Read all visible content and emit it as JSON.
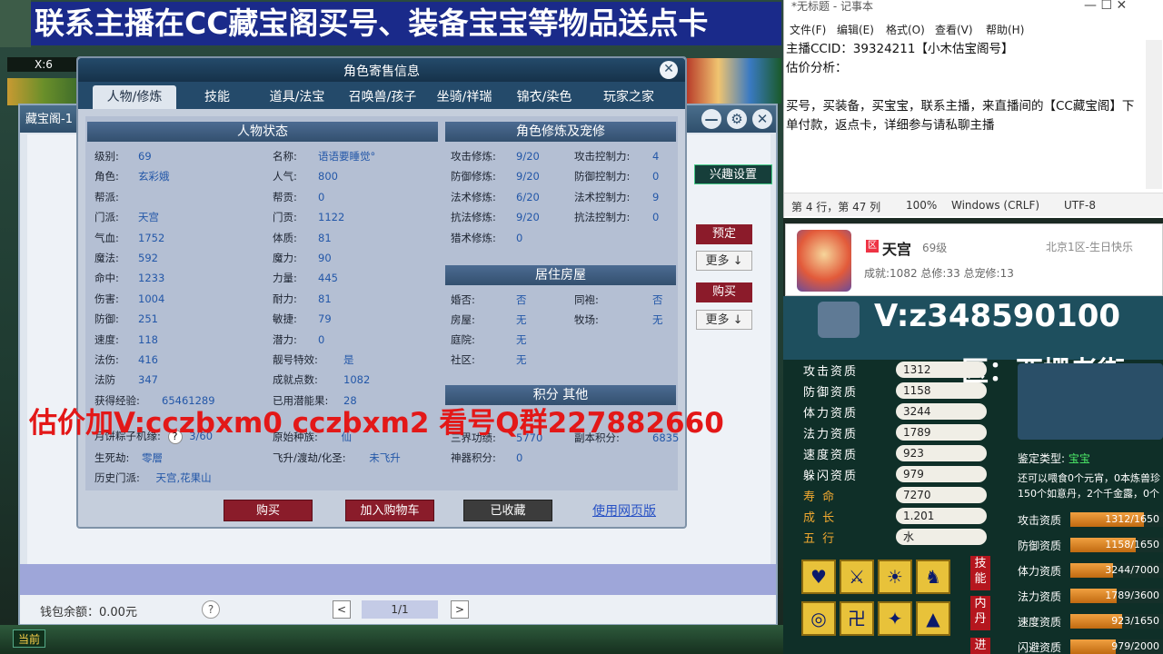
{
  "banner": "联系主播在CC藏宝阁买号、装备宝宝等物品送点卡",
  "game": {
    "x_label": "X:6"
  },
  "cbg": {
    "title": "藏宝阁-1",
    "hobby_button": "兴趣设置",
    "side_buttons": [
      "预定",
      "更多 ↓",
      "购买",
      "更多 ↓"
    ],
    "wallet": "钱包余额：0.00元",
    "help": "?",
    "pager": "1/1",
    "prev": "<",
    "next": ">"
  },
  "dialog": {
    "title": "角色寄售信息",
    "close": "✕",
    "tabs": [
      "人物/修炼",
      "技能",
      "道具/法宝",
      "召唤兽/孩子",
      "坐骑/祥瑞",
      "锦衣/染色",
      "玩家之家"
    ],
    "status_title": "人物状态",
    "status_left": [
      {
        "label": "级别:",
        "value": "69"
      },
      {
        "label": "角色:",
        "value": "玄彩娥"
      },
      {
        "label": "帮派:",
        "value": ""
      },
      {
        "label": "门派:",
        "value": "天宫"
      },
      {
        "label": "气血:",
        "value": "1752"
      },
      {
        "label": "魔法:",
        "value": "592"
      },
      {
        "label": "命中:",
        "value": "1233"
      },
      {
        "label": "伤害:",
        "value": "1004"
      },
      {
        "label": "防御:",
        "value": "251"
      },
      {
        "label": "速度:",
        "value": "118"
      },
      {
        "label": "法伤:",
        "value": "416"
      },
      {
        "label": "法防",
        "value": "347"
      },
      {
        "label": "获得经验:",
        "value": "65461289"
      }
    ],
    "status_right": [
      {
        "label": "名称:",
        "value": "语语要睡觉°"
      },
      {
        "label": "人气:",
        "value": "800"
      },
      {
        "label": "帮贡:",
        "value": "0"
      },
      {
        "label": "门贡:",
        "value": "1122"
      },
      {
        "label": "体质:",
        "value": "81"
      },
      {
        "label": "魔力:",
        "value": "90"
      },
      {
        "label": "力量:",
        "value": "445"
      },
      {
        "label": "耐力:",
        "value": "81"
      },
      {
        "label": "敏捷:",
        "value": "79"
      },
      {
        "label": "潜力:",
        "value": "0"
      },
      {
        "label": "靓号特效:",
        "value": "是"
      },
      {
        "label": "成就点数:",
        "value": "1082"
      },
      {
        "label": "已用潜能果:",
        "value": "28"
      }
    ],
    "extra_rows": [
      {
        "label": "月饼粽子机缘:",
        "value": "3/60",
        "label2": "原始种族:",
        "value2": "仙"
      },
      {
        "label": "生死劫:",
        "value": "零層",
        "label2": "飞升/渡劫/化圣:",
        "value2": "未飞升"
      },
      {
        "label": "历史门派:",
        "value": "天宫,花果山"
      }
    ],
    "cultivation_title": "角色修炼及宠修",
    "cultivation": [
      {
        "label": "攻击修炼:",
        "value": "9/20",
        "label2": "攻击控制力:",
        "value2": "4"
      },
      {
        "label": "防御修炼:",
        "value": "9/20",
        "label2": "防御控制力:",
        "value2": "0"
      },
      {
        "label": "法术修炼:",
        "value": "6/20",
        "label2": "法术控制力:",
        "value2": "9"
      },
      {
        "label": "抗法修炼:",
        "value": "9/20",
        "label2": "抗法控制力:",
        "value2": "0"
      },
      {
        "label": "猎术修炼:",
        "value": "0"
      }
    ],
    "house_title": "居住房屋",
    "house": [
      {
        "label": "婚否:",
        "value": "否",
        "label2": "同袍:",
        "value2": "否"
      },
      {
        "label": "房屋:",
        "value": "无",
        "label2": "牧场:",
        "value2": "无"
      },
      {
        "label": "庭院:",
        "value": "无"
      },
      {
        "label": "社区:",
        "value": "无"
      }
    ],
    "points_title": "积分 其他",
    "points": [
      {
        "label": "三界功绩:",
        "value": "5770",
        "label2": "副本积分:",
        "value2": "6835"
      },
      {
        "label": "神器积分:",
        "value": "0"
      }
    ],
    "actions": {
      "buy": "购买",
      "cart": "加入购物车",
      "favorited": "已收藏",
      "web": "使用网页版"
    }
  },
  "watermark": "估价加V:cczbxm0    cczbxm2   看号Q群227882660",
  "taskbar": {
    "channel": "当前"
  },
  "notepad": {
    "title": "*无标题 - 记事本",
    "controls": "—    ☐    ✕",
    "menu": [
      "文件(F)",
      "编辑(E)",
      "格式(O)",
      "查看(V)",
      "帮助(H)"
    ],
    "lines": [
      "主播CCID：39324211【小木估宝阁号】",
      "估价分析：",
      "",
      "买号，买装备，买宝宝，联系主播，来直播间的【CC藏宝阁】下单付款，返点卡，详细参与请私聊主播"
    ],
    "status": [
      "第 4 行，第 47 列",
      "100%",
      "Windows (CRLF)",
      "UTF-8"
    ]
  },
  "card": {
    "badge": "区",
    "name": "天宫",
    "level": "69级",
    "server": "北京1区-生日快乐",
    "stats": "成就:1082 总修:33 总宠修:13"
  },
  "pet": {
    "contact": "V:z348590100",
    "server": "区：西栅老街",
    "aptitudes": [
      {
        "label": "攻击资质",
        "value": "1312"
      },
      {
        "label": "防御资质",
        "value": "1158"
      },
      {
        "label": "体力资质",
        "value": "3244"
      },
      {
        "label": "法力资质",
        "value": "1789"
      },
      {
        "label": "速度资质",
        "value": "923"
      },
      {
        "label": "躲闪资质",
        "value": "979"
      },
      {
        "label": "寿    命",
        "value": "7270"
      },
      {
        "label": "成    长",
        "value": "1.201"
      },
      {
        "label": "五    行",
        "value": "水"
      }
    ],
    "type_label": "鉴定类型:",
    "type_value": "宝宝",
    "desc": [
      "还可以喂食0个元宵，0本炼兽珍",
      "150个如意丹，2个千金露，0个"
    ],
    "bars": [
      {
        "label": "攻击资质",
        "text": "1312/1650",
        "fraction": 0.795
      },
      {
        "label": "防御资质",
        "text": "1158/1650",
        "fraction": 0.702
      },
      {
        "label": "体力资质",
        "text": "3244/7000",
        "fraction": 0.463
      },
      {
        "label": "法力资质",
        "text": "1789/3600",
        "fraction": 0.497
      },
      {
        "label": "速度资质",
        "text": "923/1650",
        "fraction": 0.559
      },
      {
        "label": "闪避资质",
        "text": "979/2000",
        "fraction": 0.49
      }
    ],
    "skill_tabs": [
      "技能",
      "内丹",
      "进"
    ],
    "skill_icons": [
      "heart-shield",
      "crossed-swords",
      "sun-wheel",
      "runner",
      "swirl",
      "rune",
      "wing",
      "mountain"
    ]
  }
}
